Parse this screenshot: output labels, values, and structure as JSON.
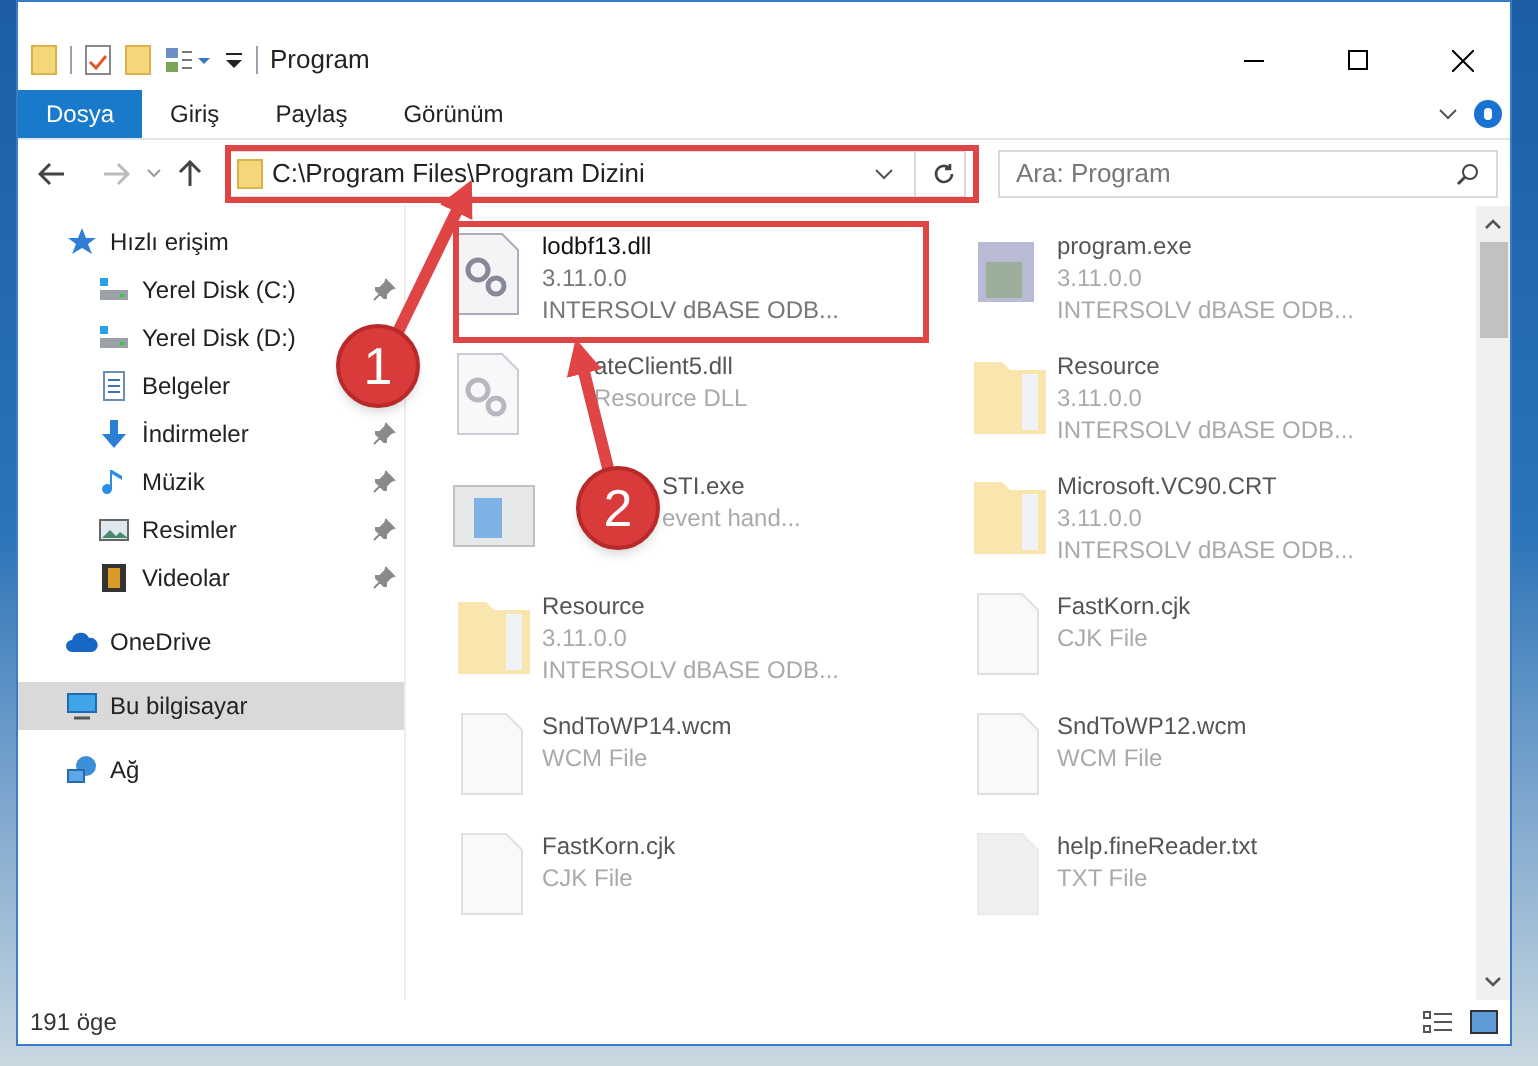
{
  "window": {
    "title": "Program"
  },
  "ribbon_tabs": [
    {
      "label": "Dosya",
      "selected": true
    },
    {
      "label": "Giriş",
      "selected": false
    },
    {
      "label": "Paylaş",
      "selected": false
    },
    {
      "label": "Görünüm",
      "selected": false
    }
  ],
  "address_bar": {
    "path": "C:\\Program Files\\Program Dizini"
  },
  "search": {
    "placeholder": "Ara: Program"
  },
  "sidebar": {
    "items": [
      {
        "label": "Hızlı erişim",
        "kind": "star",
        "selected": false,
        "children": [
          {
            "label": "Yerel Disk (C:)",
            "kind": "drive",
            "pinned": true,
            "selected": false
          },
          {
            "label": "Yerel Disk (D:)",
            "kind": "drive",
            "pinned": false,
            "selected": false
          },
          {
            "label": "Belgeler",
            "kind": "docs",
            "pinned": false,
            "selected": false
          },
          {
            "label": "İndirmeler",
            "kind": "download",
            "pinned": true,
            "selected": false
          },
          {
            "label": "Müzik",
            "kind": "music",
            "pinned": true,
            "selected": false
          },
          {
            "label": "Resimler",
            "kind": "pictures",
            "pinned": true,
            "selected": false
          },
          {
            "label": "Videolar",
            "kind": "video",
            "pinned": true,
            "selected": false
          }
        ]
      },
      {
        "label": "OneDrive",
        "kind": "cloud",
        "selected": false
      },
      {
        "label": "Bu bilgisayar",
        "kind": "computer",
        "selected": true
      },
      {
        "label": "Ağ",
        "kind": "network",
        "selected": false
      }
    ]
  },
  "files": [
    {
      "name": "lodbf13.dll",
      "details": [
        "3.11.0.0",
        "INTERSOLV dBASE ODB..."
      ],
      "kind": "dll",
      "highlighted": true
    },
    {
      "name": "program.exe",
      "details": [
        "3.11.0.0",
        "INTERSOLV dBASE ODB..."
      ],
      "kind": "exe",
      "highlighted": false
    },
    {
      "name": "ateClient5.dll",
      "details": [
        "Resource DLL"
      ],
      "kind": "dll",
      "highlighted": false
    },
    {
      "name": "Resource",
      "details": [
        "3.11.0.0",
        "INTERSOLV dBASE ODB..."
      ],
      "kind": "folder",
      "highlighted": false
    },
    {
      "name": "STI.exe",
      "details": [
        "event hand..."
      ],
      "kind": "app",
      "highlighted": false
    },
    {
      "name": "Microsoft.VC90.CRT",
      "details": [
        "3.11.0.0",
        "INTERSOLV dBASE ODB..."
      ],
      "kind": "folder",
      "highlighted": false
    },
    {
      "name": "Resource",
      "details": [
        "3.11.0.0",
        "INTERSOLV dBASE ODB..."
      ],
      "kind": "folder",
      "highlighted": false
    },
    {
      "name": "FastKorn.cjk",
      "details": [
        "CJK File"
      ],
      "kind": "file",
      "highlighted": false
    },
    {
      "name": "SndToWP14.wcm",
      "details": [
        "WCM File"
      ],
      "kind": "file",
      "highlighted": false
    },
    {
      "name": "SndToWP12.wcm",
      "details": [
        "WCM File"
      ],
      "kind": "file",
      "highlighted": false
    },
    {
      "name": "FastKorn.cjk",
      "details": [
        "CJK File"
      ],
      "kind": "file",
      "highlighted": false
    },
    {
      "name": "help.fineReader.txt",
      "details": [
        "TXT File"
      ],
      "kind": "txt",
      "highlighted": false
    }
  ],
  "status_bar": {
    "count": "191 öge"
  },
  "annotations": [
    {
      "label": "1"
    },
    {
      "label": "2"
    }
  ]
}
